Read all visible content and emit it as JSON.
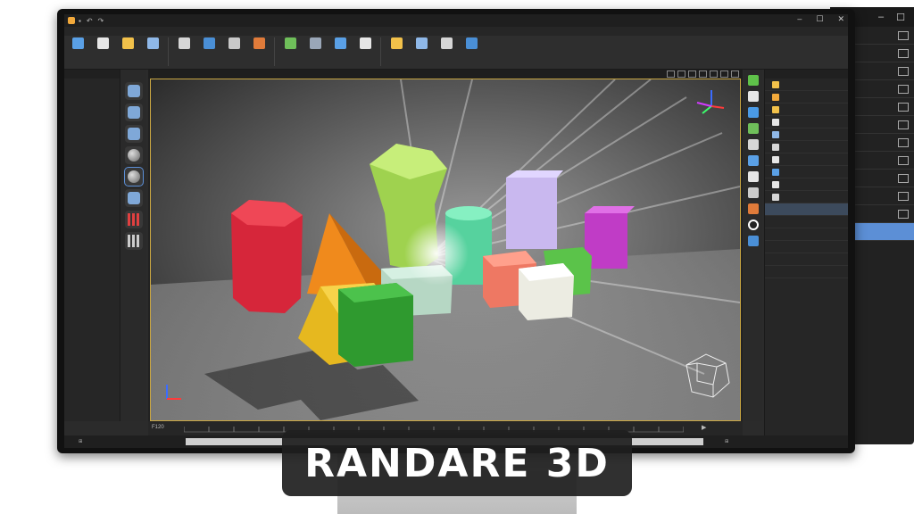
{
  "brand": {
    "banner_text": "RANDARE 3D"
  },
  "colors": {
    "accent": "#c9a642",
    "selection": "#5c8fd6",
    "panel": "#262626"
  },
  "window": {
    "minimize": "–",
    "maximize": "☐",
    "close": "✕"
  },
  "back_monitor": {
    "minimize": "–",
    "maximize": "☐"
  },
  "viewport": {
    "frame_label": "F120"
  },
  "status": {
    "left_label": "⊞",
    "right_label": "⊞"
  },
  "icons": {
    "ribbon": [
      "folder-icon",
      "brush-icon",
      "grid-icon",
      "cursor-icon",
      "move-icon",
      "image-icon",
      "cube-icon",
      "light-icon",
      "camera-icon",
      "wand-icon",
      "render-icon",
      "sphere-icon",
      "cloud-icon",
      "texture-icon",
      "crossed-tools-icon",
      "settings-icon"
    ],
    "tools": [
      "sculpt-icon",
      "smooth-icon",
      "pinch-icon",
      "sphere-icon",
      "sphere-selected-icon",
      "cube-icon",
      "grid-red-icon",
      "grid-icon"
    ],
    "right_strip": [
      "green-icon",
      "cube-icon",
      "light-icon",
      "paint-icon",
      "camera-icon",
      "box-icon",
      "sphere-icon",
      "gear-icon",
      "palette-icon",
      "target-icon",
      "blue-square-icon"
    ],
    "outliner": [
      "group-icon",
      "folder-icon",
      "light-icon",
      "texture-icon",
      "layer-icon",
      "image-icon",
      "camera-icon",
      "mesh-icon",
      "audio-icon",
      "cube-icon"
    ]
  }
}
